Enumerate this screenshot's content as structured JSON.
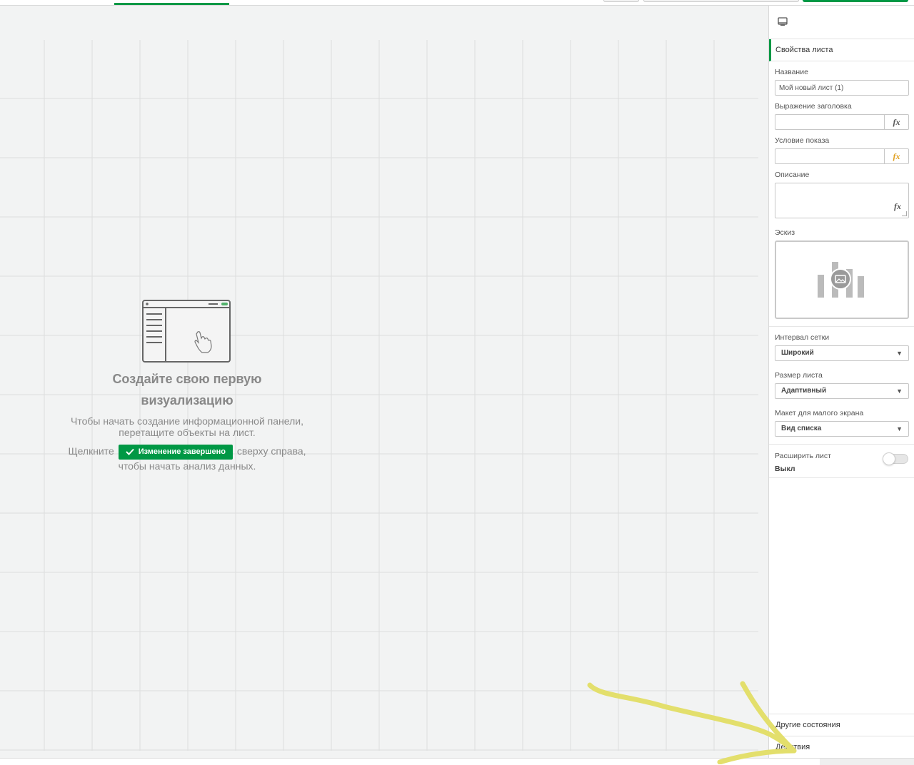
{
  "empty_state": {
    "title_line1": "Создайте свою первую",
    "title_line2": "визуализацию",
    "text_line1": "Чтобы начать создание информационной панели,",
    "text_line2": "перетащите объекты на лист.",
    "click_prefix": "Щелкните",
    "done_button_label": "Изменение завершено",
    "click_suffix": "сверху справа,",
    "click_line2": "чтобы начать анализ данных."
  },
  "panel": {
    "header_icon": "sheet-icon",
    "section_label": "Свойства листа",
    "name_label": "Название",
    "name_value": "Мой новый лист (1)",
    "title_expr_label": "Выражение заголовка",
    "title_expr_value": "",
    "show_condition_label": "Условие показа",
    "show_condition_value": "",
    "description_label": "Описание",
    "fx_label": "fx",
    "thumbnail_label": "Эскиз",
    "grid_spacing_label": "Интервал сетки",
    "grid_spacing_value": "Широкий",
    "sheet_size_label": "Размер листа",
    "sheet_size_value": "Адаптивный",
    "small_screen_label": "Макет для малого экрана",
    "small_screen_value": "Вид списка",
    "extend_sheet_label": "Расширить лист",
    "extend_sheet_value": "Выкл",
    "alternate_states_label": "Другие состояния",
    "actions_label": "Действия"
  },
  "colors": {
    "accent_green": "#009845",
    "annotation_yellow": "#e3df6c",
    "fx_gold": "#e0a020"
  }
}
